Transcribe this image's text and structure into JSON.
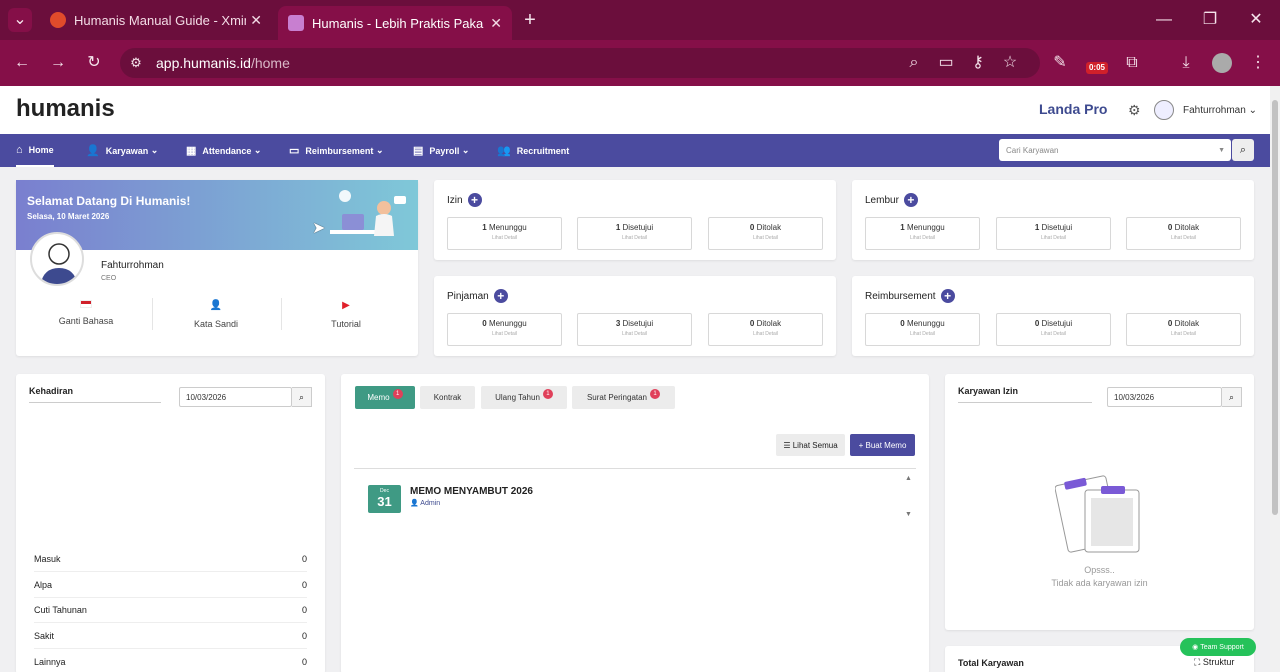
{
  "browser": {
    "tabs": [
      {
        "title": "Humanis Manual Guide - Xmind"
      },
      {
        "title": "Humanis - Lebih Praktis Pakai Humanis"
      }
    ],
    "url_host": "app.humanis.id",
    "url_path": "/home",
    "ext_badge": "0:05"
  },
  "app": {
    "logo": "humanis",
    "plan": "Landa Pro",
    "user": "Fahturrohman"
  },
  "nav": {
    "items": [
      {
        "label": "Home"
      },
      {
        "label": "Karyawan"
      },
      {
        "label": "Attendance"
      },
      {
        "label": "Reimbursement"
      },
      {
        "label": "Payroll"
      },
      {
        "label": "Recruitment"
      }
    ],
    "search_placeholder": "Cari Karyawan"
  },
  "welcome": {
    "title": "Selamat Datang Di Humanis!",
    "date": "Selasa, 10 Maret 2026",
    "name": "Fahturrohman",
    "role": "CEO",
    "actions": [
      {
        "label": "Ganti Bahasa"
      },
      {
        "label": "Kata Sandi"
      },
      {
        "label": "Tutorial"
      }
    ]
  },
  "stats": {
    "izin": {
      "title": "Izin",
      "m": "1",
      "s": "1",
      "t": "0"
    },
    "lembur": {
      "title": "Lembur",
      "m": "1",
      "s": "1",
      "t": "0"
    },
    "pinjaman": {
      "title": "Pinjaman",
      "m": "0",
      "s": "3",
      "t": "0"
    },
    "reimb": {
      "title": "Reimbursement",
      "m": "0",
      "s": "0",
      "t": "0"
    },
    "labels": {
      "menunggu": "Menunggu",
      "disetujui": "Disetujui",
      "ditolak": "Ditolak",
      "detail": "Lihat Detail"
    }
  },
  "kehadiran": {
    "title": "Kehadiran",
    "date": "10/03/2026",
    "rows": [
      {
        "label": "Masuk",
        "value": "0"
      },
      {
        "label": "Alpa",
        "value": "0"
      },
      {
        "label": "Cuti Tahunan",
        "value": "0"
      },
      {
        "label": "Sakit",
        "value": "0"
      },
      {
        "label": "Lainnya",
        "value": "0"
      }
    ]
  },
  "memo": {
    "tabs": [
      {
        "label": "Memo",
        "badge": "1"
      },
      {
        "label": "Kontrak"
      },
      {
        "label": "Ulang Tahun",
        "badge": "1"
      },
      {
        "label": "Surat Peringatan",
        "badge": "1"
      }
    ],
    "lihat": "Lihat Semua",
    "buat": "Buat Memo",
    "item": {
      "month": "Dec",
      "day": "31",
      "title": "MEMO MENYAMBUT 2026",
      "author": "Admin"
    }
  },
  "izin": {
    "title": "Karyawan Izin",
    "date": "10/03/2026",
    "empty1": "Opsss..",
    "empty2": "Tidak ada karyawan izin"
  },
  "total": {
    "title": "Total Karyawan",
    "struktur": "Struktur"
  },
  "support": "Team Support",
  "colors": {
    "nav": "#4b4b9f",
    "accent": "#3f9a84",
    "browser": "#850f48"
  }
}
